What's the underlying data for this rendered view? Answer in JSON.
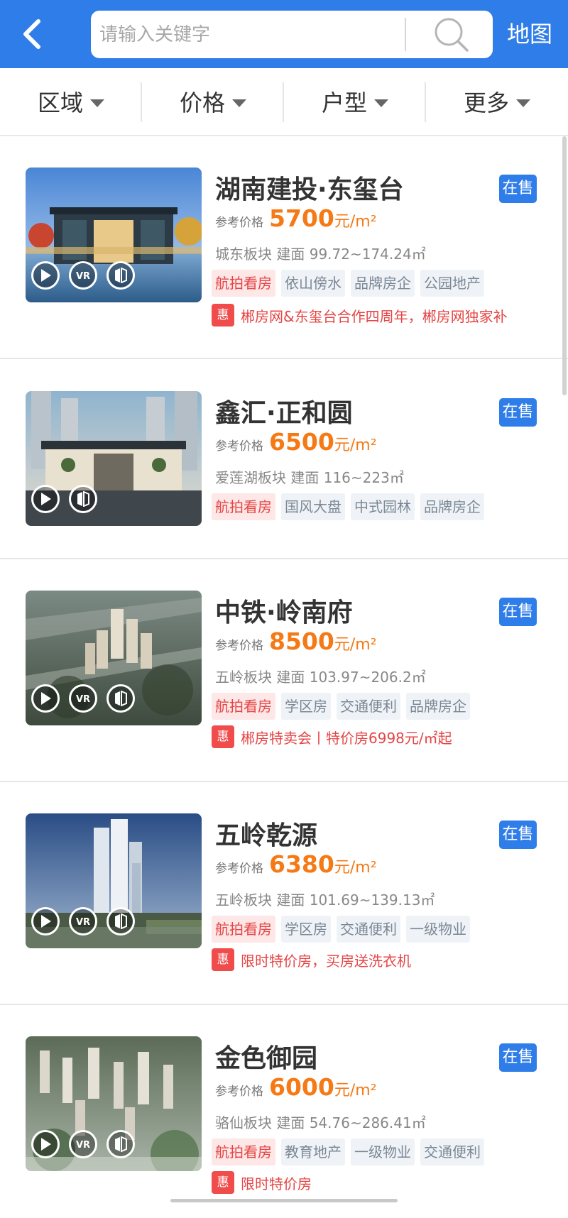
{
  "header": {
    "back_icon": "chevron-left-icon",
    "search_placeholder": "请输入关键字",
    "search_icon": "search-icon",
    "map_label": "地图"
  },
  "filters": [
    {
      "label": "区域"
    },
    {
      "label": "价格"
    },
    {
      "label": "户型"
    },
    {
      "label": "更多"
    }
  ],
  "colors": {
    "brand_blue": "#2f7de8",
    "price_orange": "#f57a16",
    "promo_red": "#e64545"
  },
  "listings": [
    {
      "title": "湖南建投·东玺台",
      "status": "在售",
      "price_label": "参考价格",
      "price": "5700",
      "price_unit": "元/m²",
      "area": "城东板块 建面 99.72~174.24㎡",
      "overlay_icons": [
        "video-play-icon",
        "vr-icon",
        "panorama-icon"
      ],
      "tags": [
        {
          "label": "航拍看房",
          "style": "hot"
        },
        {
          "label": "依山傍水",
          "style": "normal"
        },
        {
          "label": "品牌房企",
          "style": "normal"
        },
        {
          "label": "公园地产",
          "style": "normal"
        }
      ],
      "promo_badge": "惠",
      "promo": "郴房网&东玺台合作四周年，郴房网独家补"
    },
    {
      "title": "鑫汇·正和圆",
      "status": "在售",
      "price_label": "参考价格",
      "price": "6500",
      "price_unit": "元/m²",
      "area": "爱莲湖板块 建面 116~223㎡",
      "overlay_icons": [
        "video-play-icon",
        "panorama-icon"
      ],
      "tags": [
        {
          "label": "航拍看房",
          "style": "hot"
        },
        {
          "label": "国风大盘",
          "style": "normal"
        },
        {
          "label": "中式园林",
          "style": "normal"
        },
        {
          "label": "品牌房企",
          "style": "normal"
        }
      ]
    },
    {
      "title": "中铁·岭南府",
      "status": "在售",
      "price_label": "参考价格",
      "price": "8500",
      "price_unit": "元/m²",
      "area": "五岭板块 建面 103.97~206.2㎡",
      "overlay_icons": [
        "video-play-icon",
        "vr-icon",
        "panorama-icon"
      ],
      "tags": [
        {
          "label": "航拍看房",
          "style": "hot"
        },
        {
          "label": "学区房",
          "style": "normal"
        },
        {
          "label": "交通便利",
          "style": "normal"
        },
        {
          "label": "品牌房企",
          "style": "normal"
        }
      ],
      "promo_badge": "惠",
      "promo": "郴房特卖会丨特价房6998元/㎡起"
    },
    {
      "title": "五岭乾源",
      "status": "在售",
      "price_label": "参考价格",
      "price": "6380",
      "price_unit": "元/m²",
      "area": "五岭板块 建面 101.69~139.13㎡",
      "overlay_icons": [
        "video-play-icon",
        "vr-icon",
        "panorama-icon"
      ],
      "tags": [
        {
          "label": "航拍看房",
          "style": "hot"
        },
        {
          "label": "学区房",
          "style": "normal"
        },
        {
          "label": "交通便利",
          "style": "normal"
        },
        {
          "label": "一级物业",
          "style": "normal"
        }
      ],
      "promo_badge": "惠",
      "promo": "限时特价房，买房送洗衣机"
    },
    {
      "title": "金色御园",
      "status": "在售",
      "price_label": "参考价格",
      "price": "6000",
      "price_unit": "元/m²",
      "area": "骆仙板块 建面 54.76~286.41㎡",
      "overlay_icons": [
        "video-play-icon",
        "vr-icon",
        "panorama-icon"
      ],
      "tags": [
        {
          "label": "航拍看房",
          "style": "hot"
        },
        {
          "label": "教育地产",
          "style": "normal"
        },
        {
          "label": "一级物业",
          "style": "normal"
        },
        {
          "label": "交通便利",
          "style": "normal"
        }
      ],
      "promo_badge": "惠",
      "promo": "限时特价房"
    }
  ]
}
